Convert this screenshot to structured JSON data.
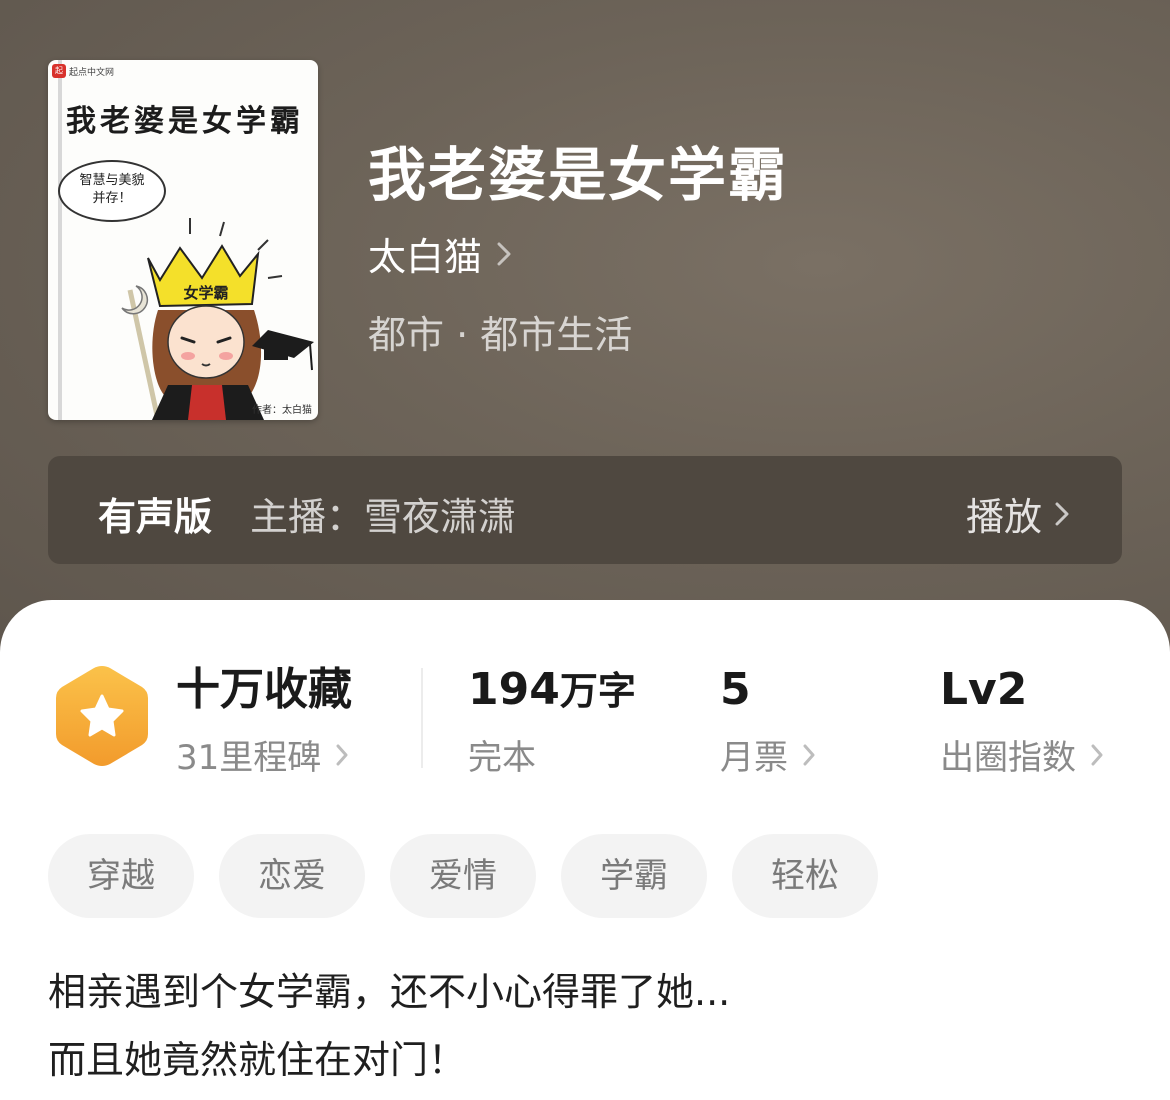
{
  "book": {
    "title": "我老婆是女学霸",
    "author": "太白猫",
    "genre": "都市 · 都市生活"
  },
  "cover": {
    "logo_mark": "起",
    "logo_text": "起点中文网",
    "title": "我老婆是女学霸",
    "bubble_line1": "智慧与美貌",
    "bubble_line2": "并存！",
    "crown_text": "女学霸",
    "author_text": "作者：太白猫"
  },
  "audio": {
    "label": "有声版",
    "host": "主播：雪夜潇潇",
    "play": "播放"
  },
  "stats": {
    "collect_main": "十万收藏",
    "collect_sub": "31里程碑",
    "words_num": "194",
    "words_unit": "万字",
    "words_sub": "完本",
    "tickets_main": "5",
    "tickets_sub": "月票",
    "level_main": "Lv2",
    "level_sub": "出圈指数"
  },
  "tags": [
    "穿越",
    "恋爱",
    "爱情",
    "学霸",
    "轻松"
  ],
  "description": {
    "line1": "相亲遇到个女学霸，还不小心得罪了她...",
    "line2": "而且她竟然就住在对门！"
  },
  "colors": {
    "hero_bg": "#6c6358",
    "audio_bg": "#4f4840",
    "badge_orange": "#f5a73a",
    "tag_bg": "#f3f3f3"
  }
}
